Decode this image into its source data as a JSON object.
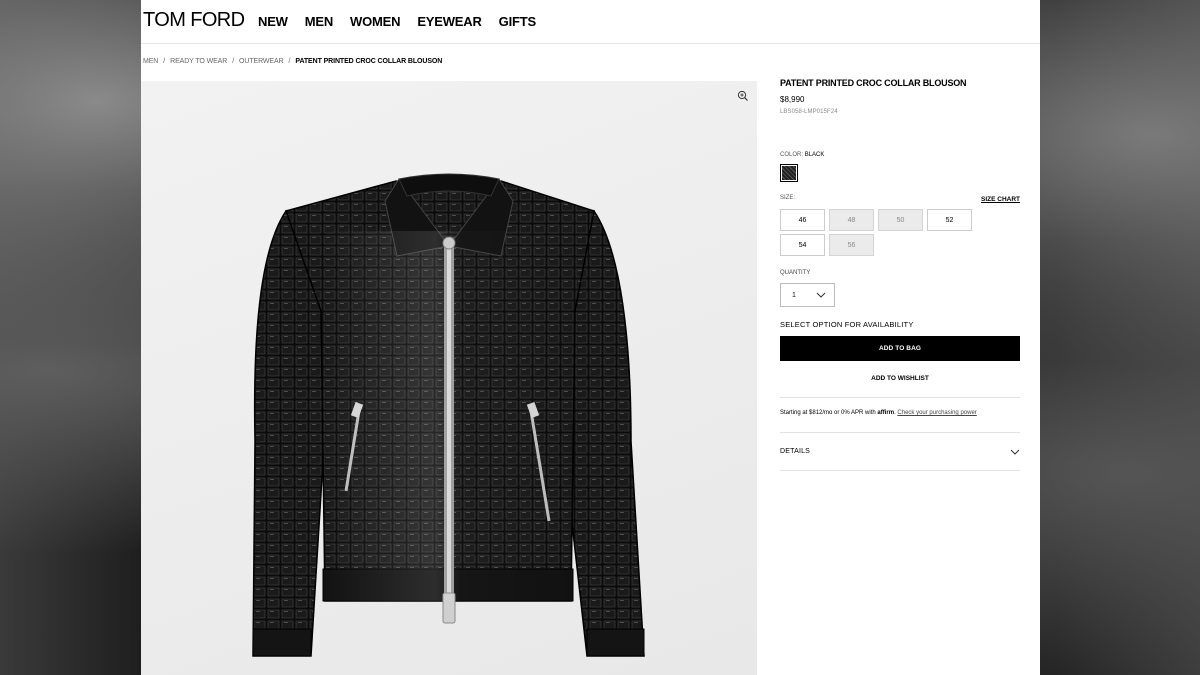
{
  "brand": {
    "logo": "TOM FORD"
  },
  "nav": [
    "NEW",
    "MEN",
    "WOMEN",
    "EYEWEAR",
    "GIFTS"
  ],
  "breadcrumb": {
    "items": [
      "MEN",
      "READY TO WEAR",
      "OUTERWEAR"
    ],
    "current": "PATENT PRINTED CROC COLLAR BLOUSON",
    "separator": "/"
  },
  "product": {
    "title": "PATENT PRINTED CROC COLLAR BLOUSON",
    "price": "$8,990",
    "sku": "LBS058-LMP015F24",
    "color_label": "COLOR:",
    "color_value": "BLACK",
    "size_label": "SIZE:",
    "size_chart": "SIZE CHART",
    "sizes": [
      {
        "label": "46",
        "available": true
      },
      {
        "label": "48",
        "available": false
      },
      {
        "label": "50",
        "available": false
      },
      {
        "label": "52",
        "available": true
      },
      {
        "label": "54",
        "available": true
      },
      {
        "label": "56",
        "available": false
      }
    ],
    "quantity_label": "QUANTITY",
    "quantity_value": "1",
    "availability_text": "SELECT OPTION FOR AVAILABILITY",
    "add_to_bag": "ADD TO BAG",
    "add_to_wishlist": "ADD TO WISHLIST",
    "affirm_text": "Starting at $812/mo or 0% APR with",
    "affirm_logo": "affirm",
    "affirm_link": "Check your purchasing power",
    "details_label": "DETAILS"
  },
  "icons": {
    "zoom": "zoom-in-icon",
    "chevron": "chevron-down-icon"
  },
  "colors": {
    "primary": "#000000",
    "unavailable_bg": "#ebebeb",
    "divider": "#e2e2e2"
  }
}
